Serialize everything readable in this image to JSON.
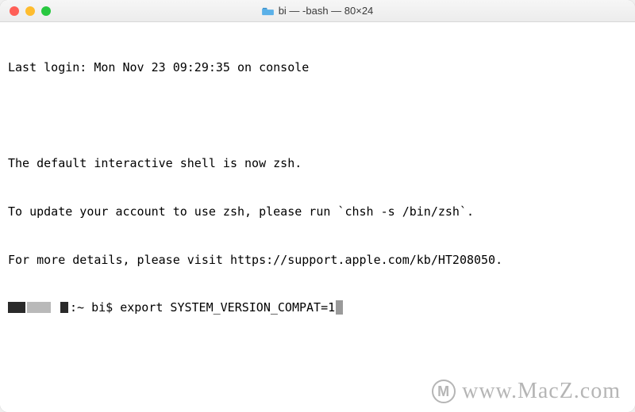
{
  "titlebar": {
    "title": "bi — -bash — 80×24"
  },
  "terminal": {
    "last_login": "Last login: Mon Nov 23 09:29:35 on console",
    "zsh_notice_1": "The default interactive shell is now zsh.",
    "zsh_notice_2": "To update your account to use zsh, please run `chsh -s /bin/zsh`.",
    "zsh_notice_3": "For more details, please visit https://support.apple.com/kb/HT208050.",
    "prompt_tail": ":~ bi$ ",
    "command": "export SYSTEM_VERSION_COMPAT=1"
  },
  "watermark": {
    "text": "www.MacZ.com",
    "badge": "M"
  }
}
